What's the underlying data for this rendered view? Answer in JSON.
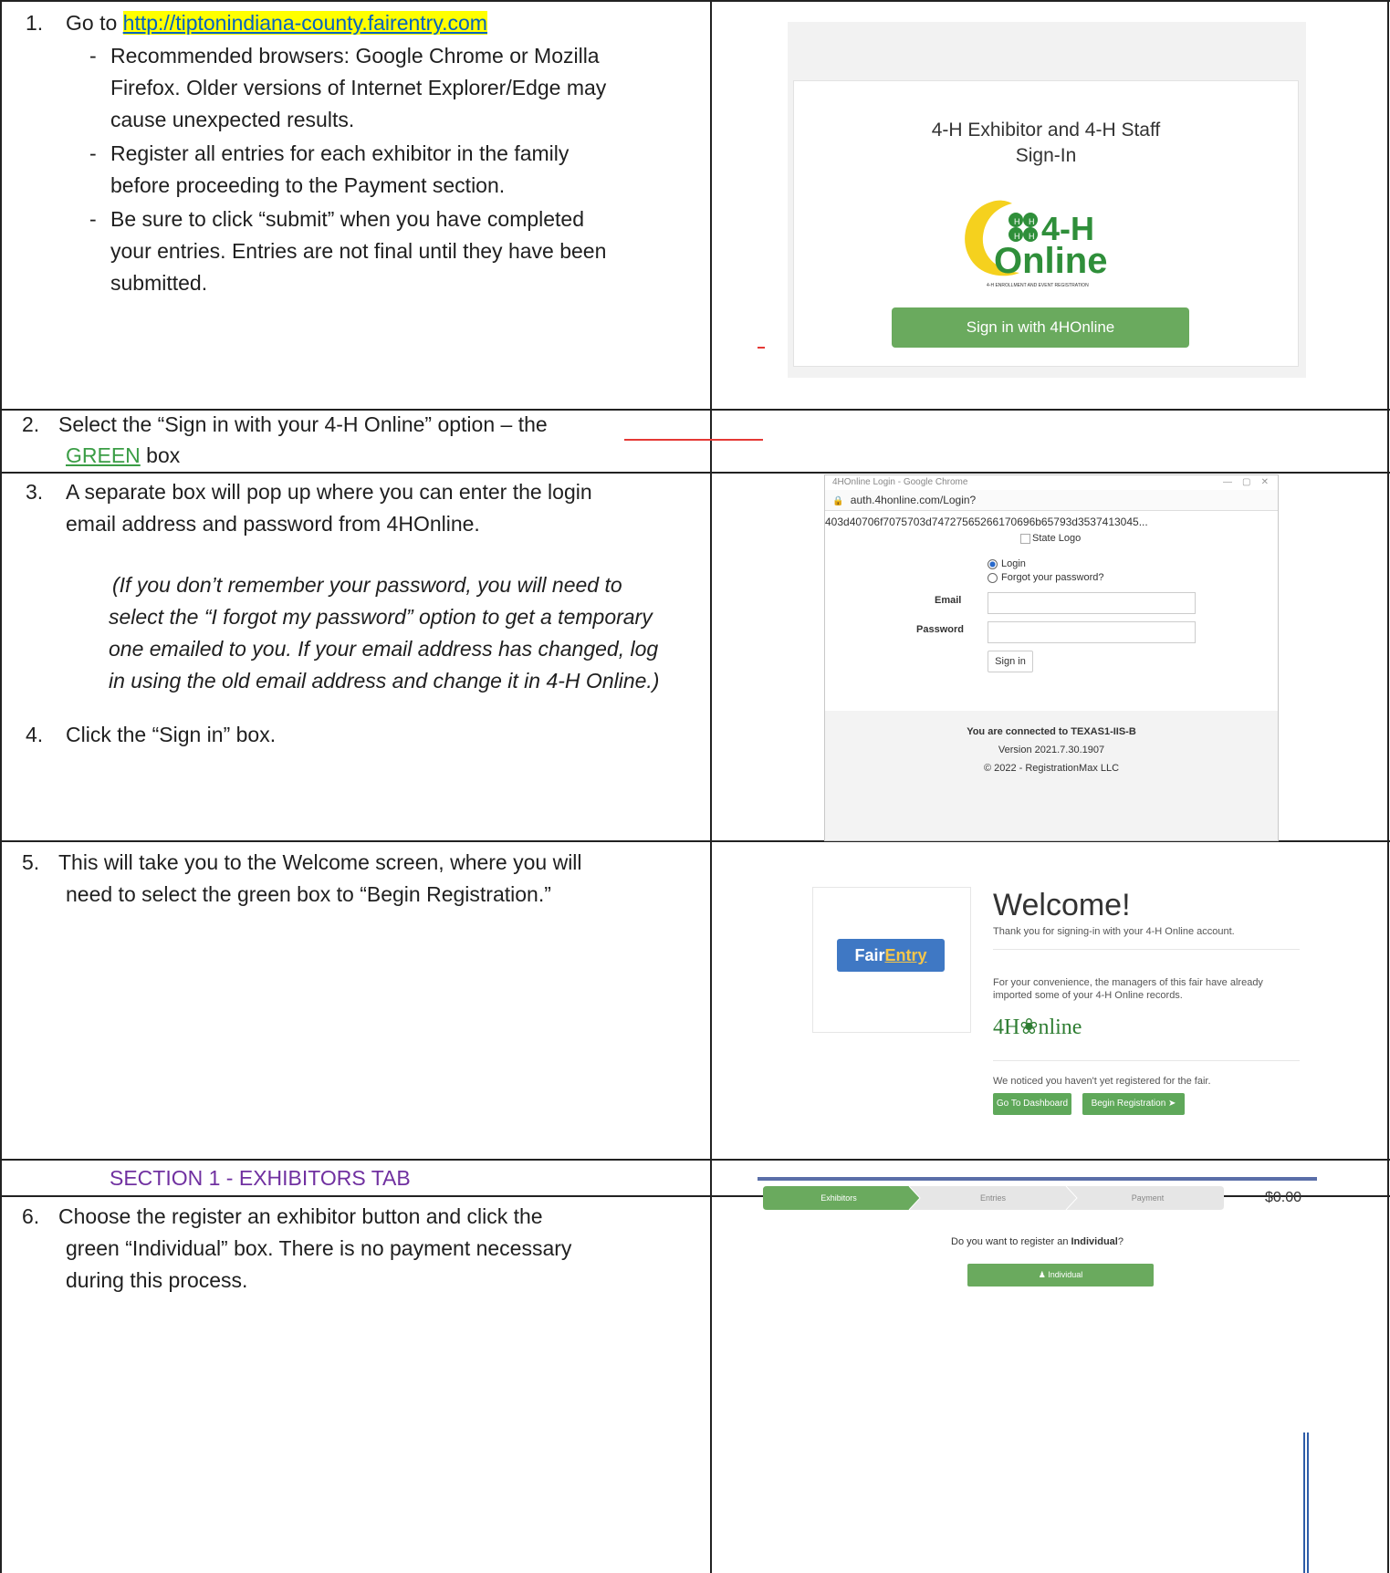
{
  "step1": {
    "num": "1.",
    "prefix": "Go to ",
    "url": "http://tiptonindiana-county.fairentry.com",
    "bullet1": [
      "Recommended browsers: Google Chrome or Mozilla",
      "Firefox. Older versions of Internet Explorer/Edge may",
      "cause unexpected results."
    ],
    "bullet2": [
      "Register all entries for each exhibitor in the family",
      "before proceeding to the Payment section."
    ],
    "bullet3": [
      "Be sure to click “submit” when you have completed",
      "your entries. Entries are not final until they have been",
      "submitted."
    ]
  },
  "step2": {
    "num": "2.",
    "line1": "Select the “Sign in with your 4-H Online” option – the",
    "green": "GREEN",
    "tail": " box"
  },
  "step3": {
    "num": "3.",
    "lines": [
      "A separate box will pop up where you can enter the login",
      "email address and password from 4HOnline."
    ],
    "note": [
      "(If you don’t remember your password, you will need to",
      "select the “I forgot my password” option to get a temporary",
      "one emailed to you.  If your email address has changed, log",
      "in using the old email address and change it in 4-H Online.)"
    ]
  },
  "step4": {
    "num": "4.",
    "text": "Click the “Sign in” box."
  },
  "step5": {
    "num": "5.",
    "lines": [
      "This will take you to the Welcome screen, where you will",
      "need to select the green box to “Begin Registration.”"
    ]
  },
  "section1": {
    "label": "SECTION 1 - EXHIBITORS TAB"
  },
  "step6": {
    "num": "6.",
    "lines": [
      "Choose the register an exhibitor button and click the",
      "green “Individual” box. There is no payment necessary",
      "during this process."
    ]
  },
  "shot1": {
    "title_line1": "4-H Exhibitor and 4-H Staff",
    "title_line2": "Sign-In",
    "logo_top": "4-H",
    "logo_bottom": "Online",
    "logo_sub": "4-H ENROLLMENT AND EVENT REGISTRATION",
    "button": "Sign in with 4HOnline"
  },
  "shot2": {
    "window_title": "4HOnline Login - Google Chrome",
    "url": "auth.4honline.com/Login?403d40706f7075703d74727565266170696b65793d3537413045...",
    "logo_alt": "State Logo",
    "radio_login": "Login",
    "radio_forgot": "Forgot your password?",
    "email_label": "Email",
    "password_label": "Password",
    "sign_in": "Sign in",
    "footer1": "You are connected to TEXAS1-IIS-B",
    "footer2": "Version 2021.7.30.1907",
    "footer3": "© 2022 - RegistrationMax LLC"
  },
  "shot3": {
    "tag_fair": "Fair",
    "tag_entry": "Entry",
    "heading": "Welcome!",
    "p1": "Thank you for signing-in with your 4-H Online account.",
    "p2a": "For your convenience, the managers of this fair have already",
    "p2b": "imported some of your 4-H Online records.",
    "logo": "4H❀nline",
    "p3": "We noticed you haven't yet registered for the fair.",
    "btn_dashboard": "Go To Dashboard",
    "btn_begin": "Begin Registration ➤"
  },
  "shot4": {
    "steps": [
      "Exhibitors",
      "Entries",
      "Payment"
    ],
    "total": "$0.00",
    "question_pre": "Do you want to register an ",
    "question_bold": "Individual",
    "question_post": "?",
    "button": "♟ Individual"
  },
  "colors": {
    "link": "#0563c1",
    "highlight": "#ffff00",
    "section": "#7030a0",
    "green_button": "#6aaa5e"
  }
}
